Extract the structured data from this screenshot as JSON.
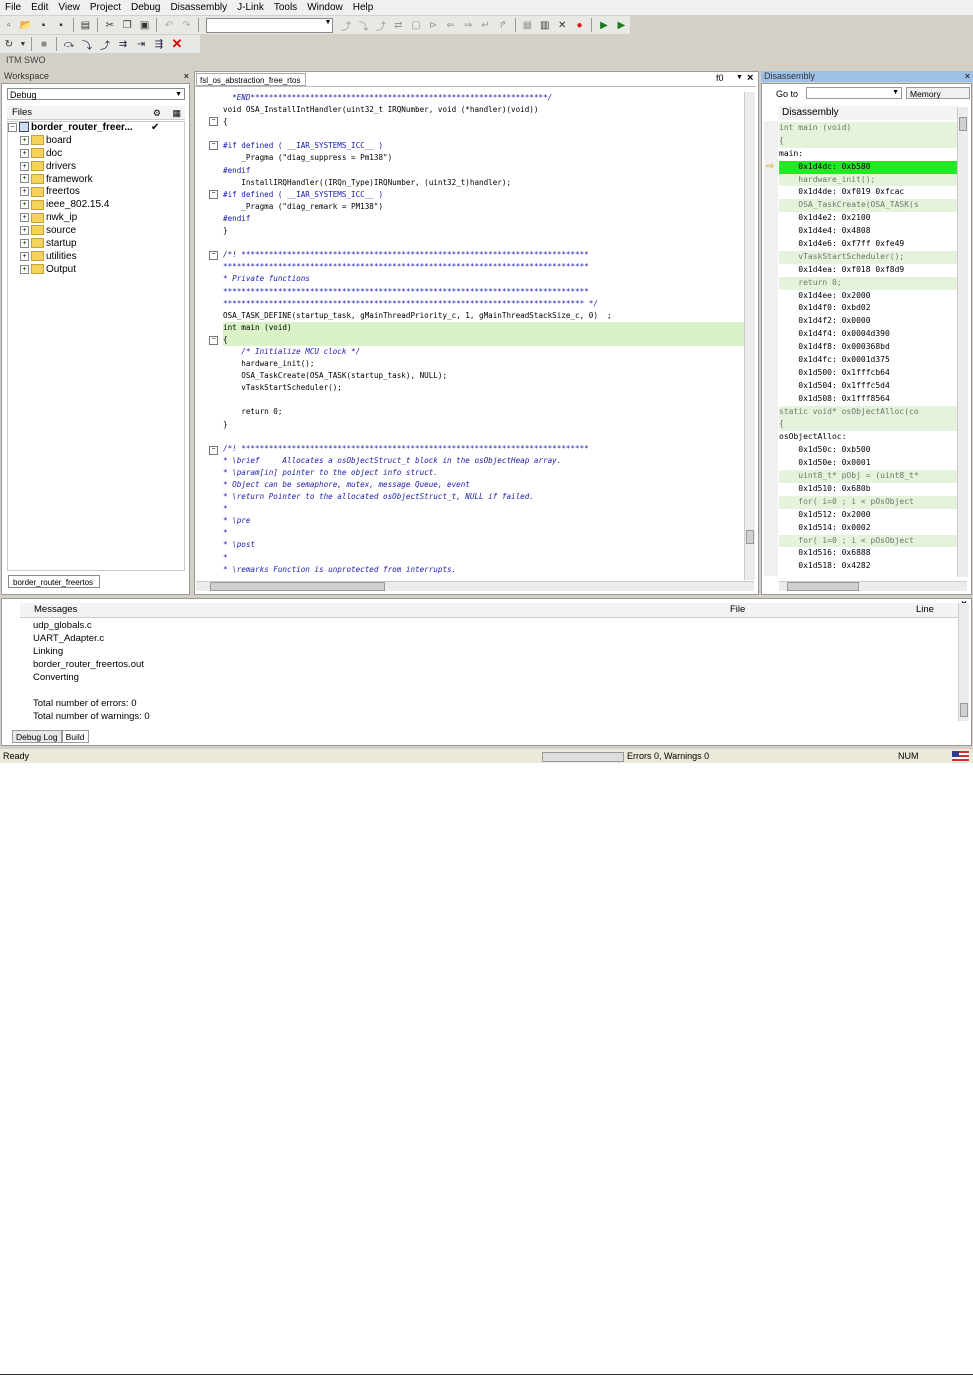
{
  "menu": [
    "File",
    "Edit",
    "View",
    "Project",
    "Debug",
    "Disassembly",
    "J-Link",
    "Tools",
    "Window",
    "Help"
  ],
  "toolbar2_extra_tabs": "ITM  SWO",
  "workspace": {
    "title": "Workspace",
    "config": "Debug",
    "files_header": "Files",
    "project": "border_router_freer...",
    "folders": [
      "board",
      "doc",
      "drivers",
      "framework",
      "freertos",
      "ieee_802.15.4",
      "nwk_ip",
      "source",
      "startup",
      "utilities",
      "Output"
    ],
    "bottom_tab": "border_router_freertos"
  },
  "editor": {
    "tab": "fsl_os_abstraction_free_rtos",
    "func_selector": "f0",
    "lines": [
      {
        "t": "  *END*****************************************************************/",
        "c": "cm"
      },
      {
        "t": "void OSA_InstallIntHandler(uint32_t IRQNumber, void (*handler)(void))",
        "c": ""
      },
      {
        "t": "{",
        "c": ""
      },
      {
        "t": "",
        "c": ""
      },
      {
        "t": "#if defined ( __IAR_SYSTEMS_ICC__ )",
        "c": "kw"
      },
      {
        "t": "    _Pragma (\"diag_suppress = Pm138\")",
        "c": ""
      },
      {
        "t": "#endif",
        "c": "kw"
      },
      {
        "t": "    InstallIRQHandler((IRQn_Type)IRQNumber, (uint32_t)handler);",
        "c": ""
      },
      {
        "t": "#if defined ( __IAR_SYSTEMS_ICC__ )",
        "c": "kw"
      },
      {
        "t": "    _Pragma (\"diag_remark = PM138\")",
        "c": ""
      },
      {
        "t": "#endif",
        "c": "kw"
      },
      {
        "t": "}",
        "c": ""
      },
      {
        "t": "",
        "c": ""
      },
      {
        "t": "/*! ****************************************************************************",
        "c": "cm"
      },
      {
        "t": "********************************************************************************",
        "c": "cm"
      },
      {
        "t": "* Private functions",
        "c": "cm"
      },
      {
        "t": "********************************************************************************",
        "c": "cm"
      },
      {
        "t": "******************************************************************************* */",
        "c": "cm"
      },
      {
        "t": "OSA_TASK_DEFINE(startup_task, gMainThreadPriority_c, 1, gMainThreadStackSize_c, 0)  ;",
        "c": ""
      },
      {
        "t": "int main (void)",
        "c": "hl"
      },
      {
        "t": "{",
        "c": "hl"
      },
      {
        "t": "    /* Initialize MCU clock */",
        "c": "cm"
      },
      {
        "t": "    hardware_init();",
        "c": ""
      },
      {
        "t": "    OSA_TaskCreate(OSA_TASK(startup_task), NULL);",
        "c": ""
      },
      {
        "t": "    vTaskStartScheduler();",
        "c": ""
      },
      {
        "t": "",
        "c": ""
      },
      {
        "t": "    return 0;",
        "c": ""
      },
      {
        "t": "}",
        "c": ""
      },
      {
        "t": "",
        "c": ""
      },
      {
        "t": "/*! ****************************************************************************",
        "c": "cm"
      },
      {
        "t": "* \\brief     Allocates a osObjectStruct_t block in the osObjectHeap array.",
        "c": "cm"
      },
      {
        "t": "* \\param[in] pointer to the object info struct.",
        "c": "cm"
      },
      {
        "t": "* Object can be semaphore, mutex, message Queue, event",
        "c": "cm"
      },
      {
        "t": "* \\return Pointer to the allocated osObjectStruct_t, NULL if failed.",
        "c": "cm"
      },
      {
        "t": "*",
        "c": "cm"
      },
      {
        "t": "* \\pre",
        "c": "cm"
      },
      {
        "t": "*",
        "c": "cm"
      },
      {
        "t": "* \\post",
        "c": "cm"
      },
      {
        "t": "*",
        "c": "cm"
      },
      {
        "t": "* \\remarks Function is unprotected from interrupts.",
        "c": "cm"
      }
    ]
  },
  "disassembly": {
    "title": "Disassembly",
    "goto_label": "Go to",
    "memory_button": "Memory",
    "header": "Disassembly",
    "lines": [
      {
        "t": "int main (void)",
        "c": "src"
      },
      {
        "t": "{",
        "c": "src"
      },
      {
        "t": "main:",
        "c": "label"
      },
      {
        "t": "    0x1d4dc: 0xb580",
        "c": "cur"
      },
      {
        "t": "    hardware_init();",
        "c": "src"
      },
      {
        "t": "    0x1d4de: 0xf019 0xfcac",
        "c": ""
      },
      {
        "t": "    OSA_TaskCreate(OSA_TASK(s",
        "c": "src"
      },
      {
        "t": "    0x1d4e2: 0x2100",
        "c": ""
      },
      {
        "t": "    0x1d4e4: 0x4808",
        "c": ""
      },
      {
        "t": "    0x1d4e6: 0xf7ff 0xfe49",
        "c": ""
      },
      {
        "t": "    vTaskStartScheduler();",
        "c": "src"
      },
      {
        "t": "    0x1d4ea: 0xf018 0xf8d9",
        "c": ""
      },
      {
        "t": "    return 0;",
        "c": "src"
      },
      {
        "t": "    0x1d4ee: 0x2000",
        "c": ""
      },
      {
        "t": "    0x1d4f0: 0xbd02",
        "c": ""
      },
      {
        "t": "    0x1d4f2: 0x0000",
        "c": ""
      },
      {
        "t": "    0x1d4f4: 0x0004d390",
        "c": ""
      },
      {
        "t": "    0x1d4f8: 0x000368bd",
        "c": ""
      },
      {
        "t": "    0x1d4fc: 0x0001d375",
        "c": ""
      },
      {
        "t": "    0x1d500: 0x1fffcb64",
        "c": ""
      },
      {
        "t": "    0x1d504: 0x1fffc5d4",
        "c": ""
      },
      {
        "t": "    0x1d508: 0x1fff8564",
        "c": ""
      },
      {
        "t": "static void* osObjectAlloc(co",
        "c": "src"
      },
      {
        "t": "{",
        "c": "src"
      },
      {
        "t": "osObjectAlloc:",
        "c": "label"
      },
      {
        "t": "    0x1d50c: 0xb500",
        "c": ""
      },
      {
        "t": "    0x1d50e: 0x0001",
        "c": ""
      },
      {
        "t": "    uint8_t* pObj = (uint8_t*",
        "c": "src"
      },
      {
        "t": "    0x1d510: 0x680b",
        "c": ""
      },
      {
        "t": "    for( i=0 ; i < pOsObject",
        "c": "src"
      },
      {
        "t": "    0x1d512: 0x2000",
        "c": ""
      },
      {
        "t": "    0x1d514: 0x0002",
        "c": ""
      },
      {
        "t": "    for( i=0 ; i < pOsObject",
        "c": "src"
      },
      {
        "t": "    0x1d516: 0x6888",
        "c": ""
      },
      {
        "t": "    0x1d518: 0x4282",
        "c": ""
      }
    ]
  },
  "messages": {
    "col_messages": "Messages",
    "col_file": "File",
    "col_line": "Line",
    "items": [
      "udp_globals.c",
      "UART_Adapter.c",
      "Linking",
      "border_router_freertos.out",
      "Converting",
      "",
      "Total number of errors: 0",
      "Total number of warnings: 0"
    ],
    "tabs": [
      "Debug Log",
      "Build"
    ]
  },
  "status": {
    "left": "Ready",
    "errors": "Errors 0, Warnings 0",
    "num": "NUM"
  }
}
